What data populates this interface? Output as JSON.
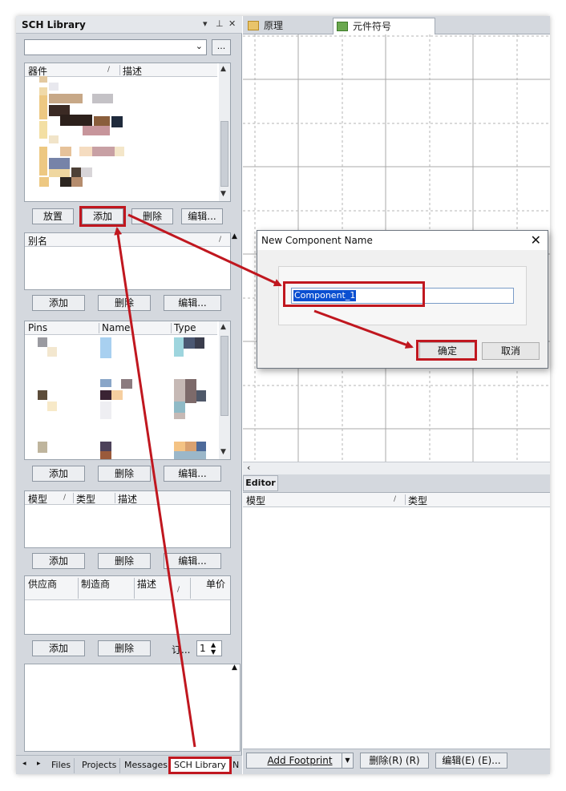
{
  "left_panel": {
    "title": "SCH Library",
    "title_controls": [
      "▾",
      "⊿",
      "✕"
    ],
    "library_filter": {
      "value": "",
      "browse_label": "..."
    },
    "components": {
      "columns": [
        "器件",
        "描述"
      ],
      "buttons": [
        "放置",
        "添加",
        "删除",
        "编辑..."
      ]
    },
    "aliases": {
      "columns": [
        "别名"
      ],
      "buttons": [
        "添加",
        "删除",
        "编辑..."
      ]
    },
    "pins": {
      "columns": [
        "Pins",
        "Name",
        "Type"
      ],
      "buttons": [
        "添加",
        "删除",
        "编辑..."
      ]
    },
    "models": {
      "columns": [
        "模型",
        "类型",
        "描述"
      ],
      "buttons": [
        "添加",
        "删除",
        "编辑..."
      ]
    },
    "suppliers": {
      "columns": [
        "供应商",
        "制造商",
        "描述",
        "单价"
      ],
      "buttons": [
        "添加",
        "删除"
      ],
      "order_label": "订...",
      "order_value": "1"
    },
    "bottom_tabs": [
      "Files",
      "Projects",
      "Messages",
      "SCH Library",
      "N"
    ]
  },
  "doc_tabs": [
    {
      "label": "原理图.SchDoc",
      "icon": "schdoc-icon"
    },
    {
      "label": "元件符号库.SchLib",
      "icon": "schlib-icon"
    }
  ],
  "editor": {
    "tab_label": "Editor",
    "columns": [
      "模型",
      "类型"
    ],
    "buttons": [
      "Add Footprint",
      "删除(R) (R)",
      "编辑(E) (E)..."
    ]
  },
  "dialog": {
    "title": "New Component Name",
    "input_value": "Component_1",
    "ok_label": "确定",
    "cancel_label": "取消"
  },
  "colors": {
    "annotation_red": "#c0171f",
    "selection_blue": "#0a4fd1"
  }
}
